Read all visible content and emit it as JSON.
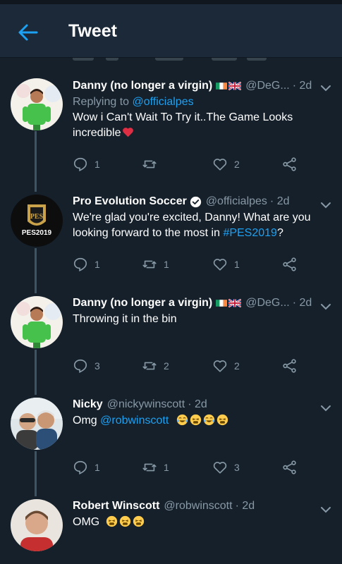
{
  "header": {
    "title": "Tweet"
  },
  "tweets": [
    {
      "name": "Danny (no longer a virgin)",
      "handle": "@DeG...",
      "time": "· 2d",
      "reply_label": "Replying to",
      "reply_handle": "@officialpes",
      "text": "Wow i Can't Wait To Try it..The Game Looks incredible",
      "replies": "1",
      "retweets": "",
      "likes": "2"
    },
    {
      "name": "Pro Evolution Soccer",
      "handle": "@officialpes",
      "time": "· 2d",
      "avatar_text": "PES2019",
      "text_before": "We're glad you're excited, Danny! What are you looking forward to the most in ",
      "hashtag": "#PES2019",
      "text_after": "?",
      "replies": "1",
      "retweets": "1",
      "likes": "1"
    },
    {
      "name": "Danny (no longer a virgin)",
      "handle": "@DeG...",
      "time": "· 2d",
      "text": "Throwing it in the bin",
      "replies": "3",
      "retweets": "2",
      "likes": "2"
    },
    {
      "name": "Nicky",
      "handle": "@nickywinscott",
      "time": "· 2d",
      "text_before": "Omg ",
      "mention": "@robwinscott",
      "replies": "1",
      "retweets": "1",
      "likes": "3"
    },
    {
      "name": "Robert Winscott",
      "handle": "@robwinscott",
      "time": "· 2d",
      "text": "OMG"
    }
  ]
}
